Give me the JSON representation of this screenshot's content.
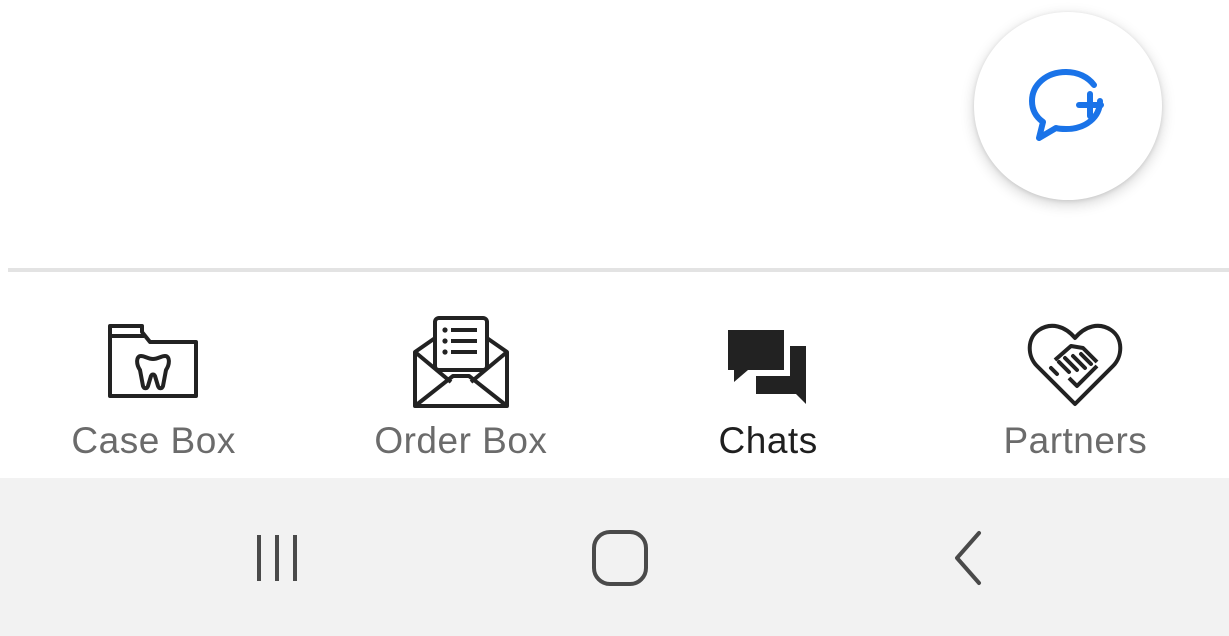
{
  "fab": {
    "icon": "chat-add-icon",
    "color": "#1a73e8"
  },
  "bottom_nav": {
    "active_index": 2,
    "items": [
      {
        "label": "Case Box",
        "icon": "tooth-folder-icon"
      },
      {
        "label": "Order Box",
        "icon": "envelope-list-icon"
      },
      {
        "label": "Chats",
        "icon": "chat-bubbles-icon"
      },
      {
        "label": "Partners",
        "icon": "heart-handshake-icon"
      }
    ]
  },
  "system_nav": {
    "buttons": [
      {
        "name": "recent-apps",
        "icon": "recent-apps-icon"
      },
      {
        "name": "home",
        "icon": "home-icon"
      },
      {
        "name": "back",
        "icon": "back-icon"
      }
    ]
  }
}
